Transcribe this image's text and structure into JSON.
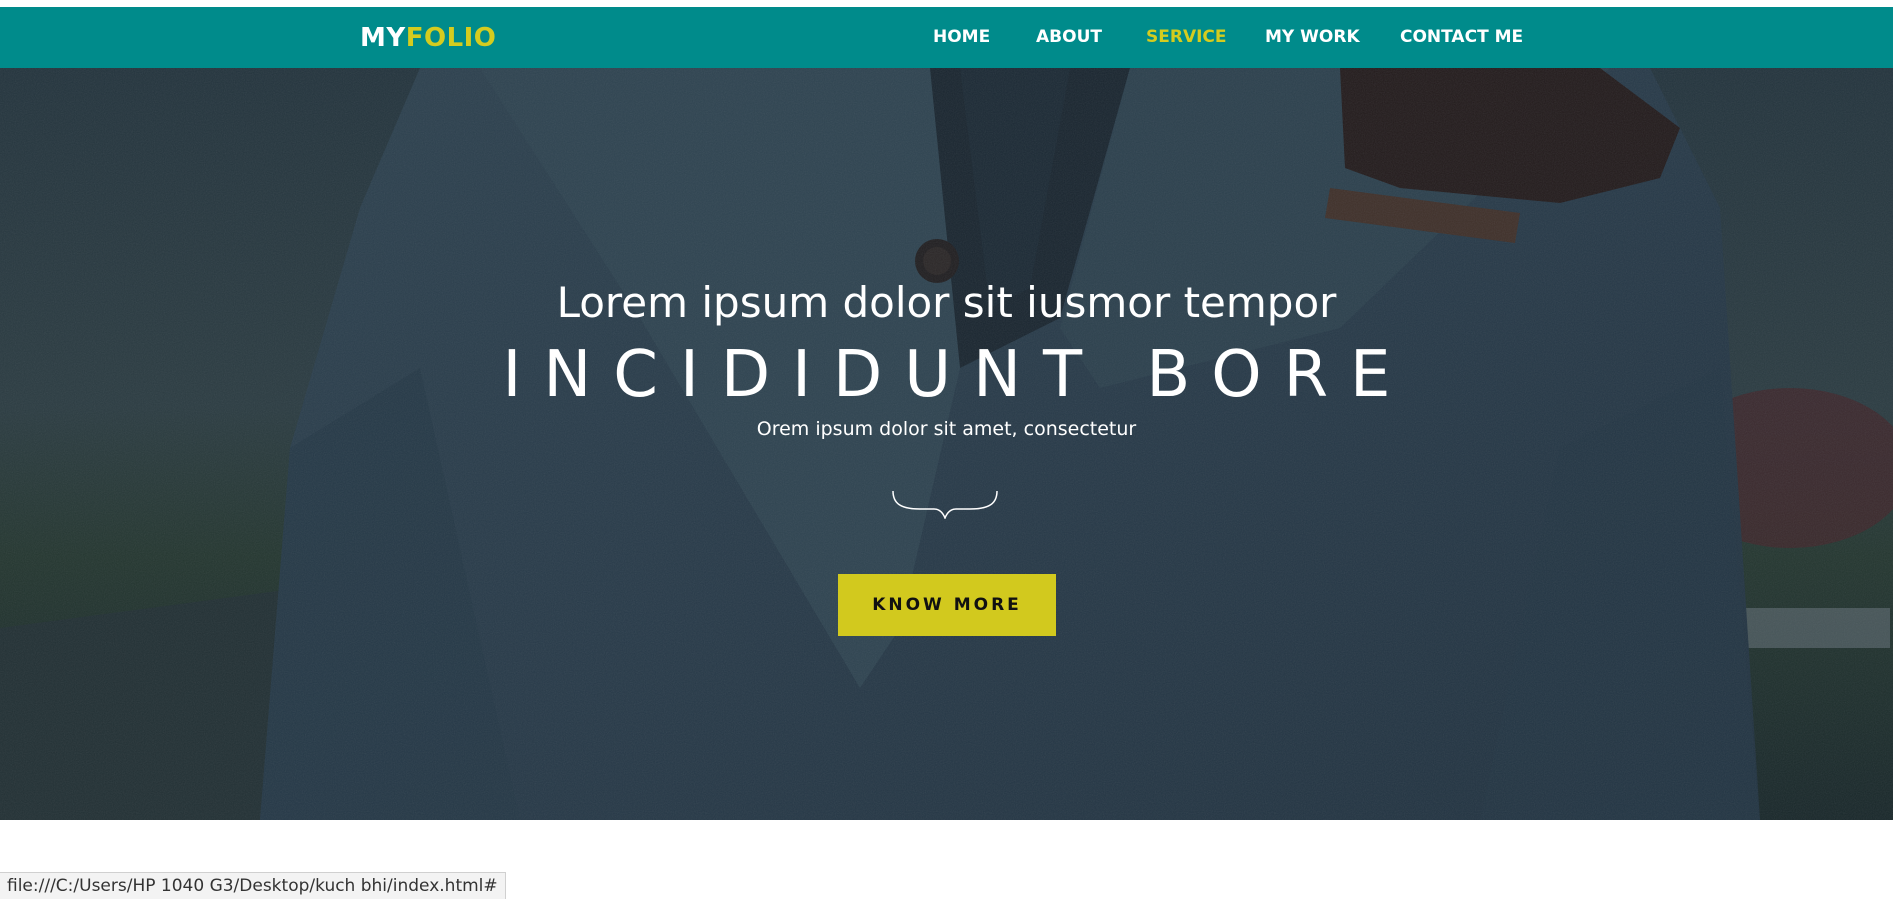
{
  "navbar": {
    "brand_part1": "MY",
    "brand_part2": "FOLIO",
    "items": [
      {
        "label": "HOME"
      },
      {
        "label": "ABOUT"
      },
      {
        "label": "SERVICE",
        "active": true
      },
      {
        "label": "MY WORK"
      },
      {
        "label": "CONTACT ME"
      }
    ]
  },
  "hero": {
    "line1": "Lorem ipsum dolor sit iusmor tempor",
    "line2": "INCIDIDUNT BORE",
    "line3": "Orem ipsum dolor sit amet, consectetur",
    "divider_icon": "curly-brace-icon",
    "cta_label": "KNOW MORE"
  },
  "status_bar": {
    "url": "file:///C:/Users/HP 1040 G3/Desktop/kuch bhi/index.html#"
  },
  "colors": {
    "nav_bg": "#008b8b",
    "accent": "#d4cc1f",
    "cta_bg": "#d2c91e"
  }
}
